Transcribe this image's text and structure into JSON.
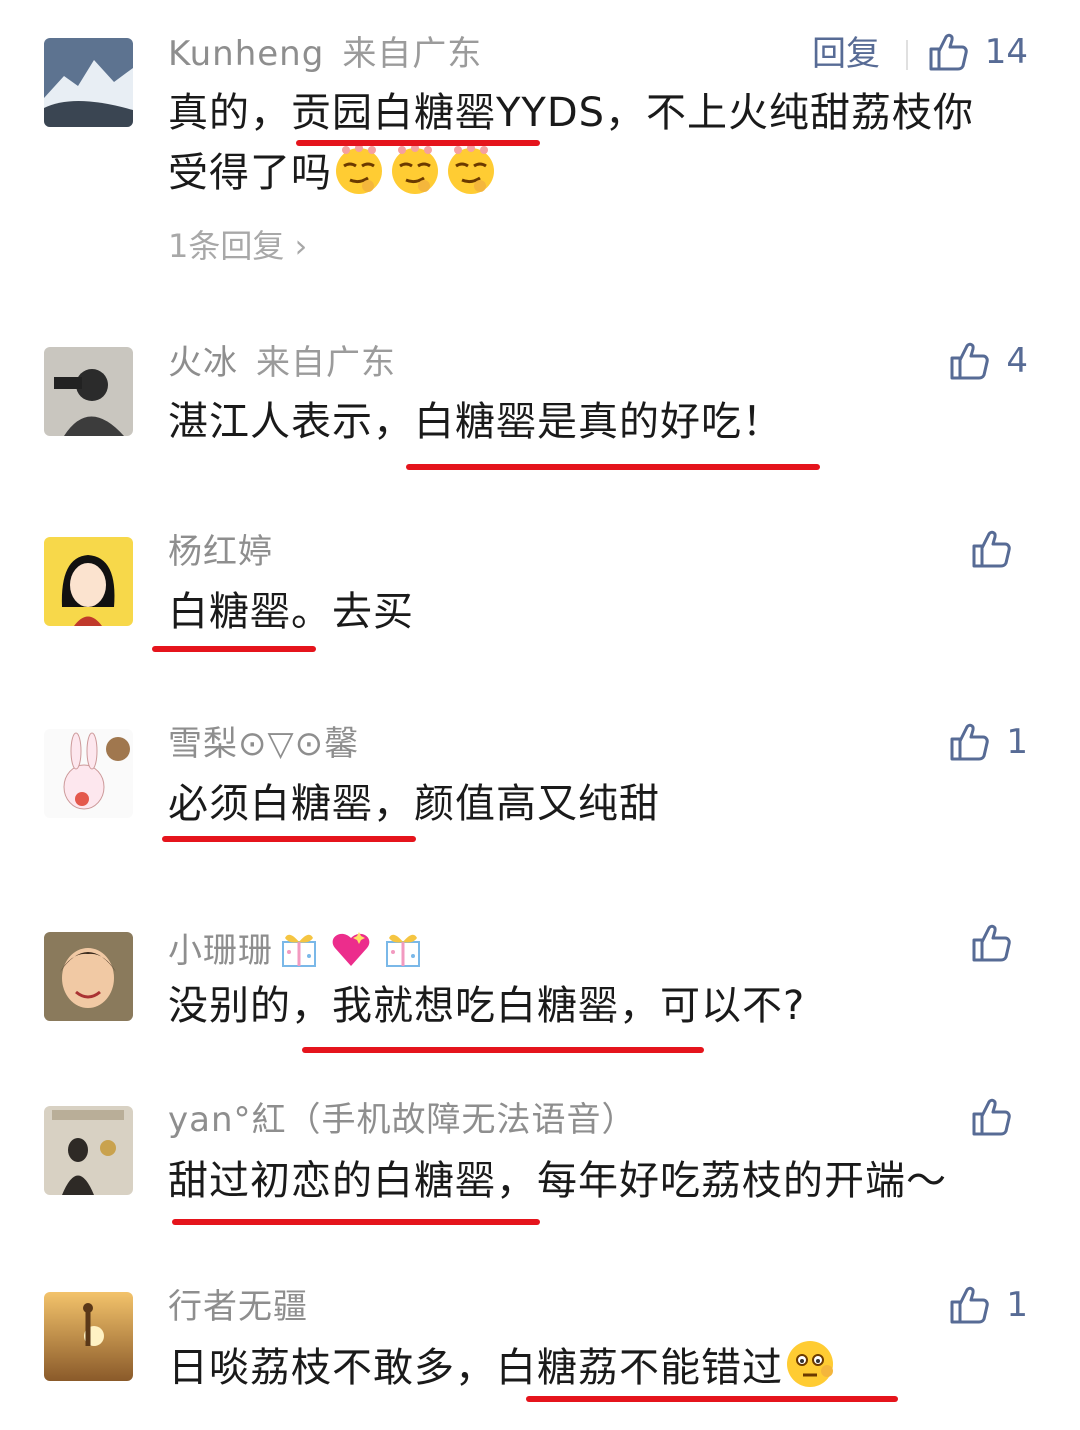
{
  "comments": [
    {
      "name": "Kunheng",
      "location": "来自广东",
      "reply_label": "回复",
      "likes": "14",
      "text_line1": "真的，贡园白糖罂YYDS，不上火纯甜荔枝你",
      "text_line2": "受得了吗",
      "replies_label": "1条回复"
    },
    {
      "name": "火冰",
      "location": "来自广东",
      "likes": "4",
      "text": "湛江人表示，白糖罂是真的好吃！"
    },
    {
      "name": "杨红婷",
      "likes": "",
      "text": "白糖罂。去买"
    },
    {
      "name": "雪梨⊙▽⊙馨",
      "likes": "1",
      "text": "必须白糖罂，颜值高又纯甜"
    },
    {
      "name": "小珊珊",
      "likes": "",
      "text": "没别的，我就想吃白糖罂，可以不?"
    },
    {
      "name": "yan°紅（手机故障无法语音）",
      "likes": "",
      "text": "甜过初恋的白糖罂，每年好吃荔枝的开端～"
    },
    {
      "name": "行者无疆",
      "likes": "1",
      "text": "日啖荔枝不敢多，白糖荔不能错过"
    }
  ],
  "icons": {
    "like": "thumbs-up-icon",
    "chevron": "chevron-right-icon"
  },
  "colors": {
    "link": "#576b95",
    "underline": "#e5141c",
    "meta": "#8e8e8e"
  }
}
